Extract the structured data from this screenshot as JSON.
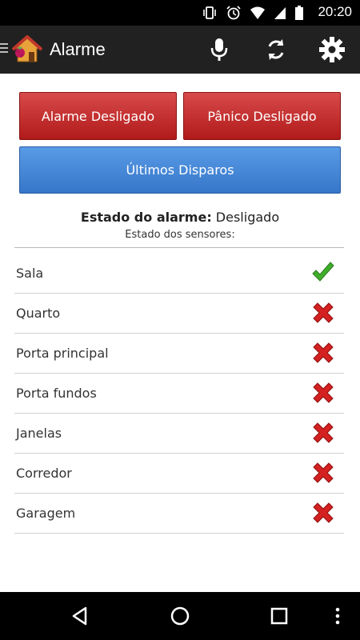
{
  "status_bar": {
    "time": "20:20",
    "icons": [
      "vibrate-icon",
      "alarm-clock-icon",
      "wifi-icon",
      "signal-icon",
      "battery-icon"
    ]
  },
  "action_bar": {
    "title": "Alarme",
    "icons": [
      "microphone-icon",
      "refresh-icon",
      "settings-gear-icon"
    ]
  },
  "buttons": {
    "alarm": "Alarme Desligado",
    "panic": "Pânico Desligado",
    "history": "Últimos Disparos"
  },
  "alarm_state": {
    "label": "Estado do alarme:",
    "value": " Desligado"
  },
  "sensors": {
    "header": "Estado dos sensores:",
    "items": [
      {
        "name": "Sala",
        "status": "ok"
      },
      {
        "name": "Quarto",
        "status": "fail"
      },
      {
        "name": "Porta principal",
        "status": "fail"
      },
      {
        "name": "Porta fundos",
        "status": "fail"
      },
      {
        "name": "Janelas",
        "status": "fail"
      },
      {
        "name": "Corredor",
        "status": "fail"
      },
      {
        "name": "Garagem",
        "status": "fail"
      }
    ]
  },
  "colors": {
    "red_button": "#c62d2d",
    "blue_button": "#4585d6",
    "check": "#3fae2a",
    "cross": "#d42020"
  }
}
